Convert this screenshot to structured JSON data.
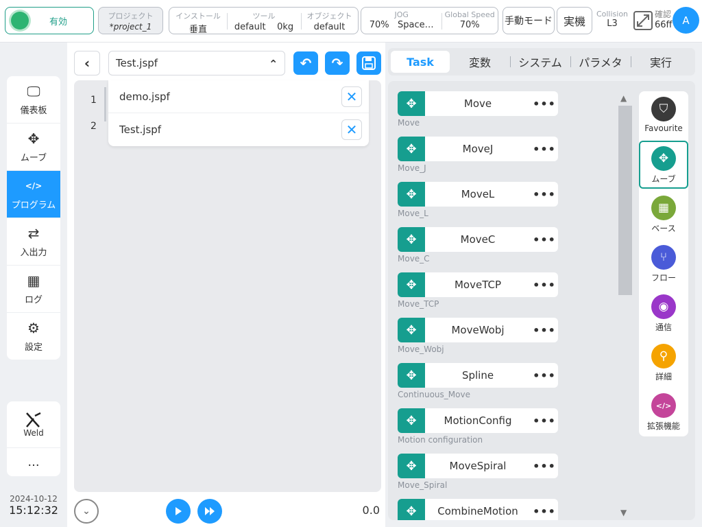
{
  "topbar": {
    "enable_label": "有効",
    "project": {
      "label": "プロジェクト",
      "value": "*project_1"
    },
    "install": {
      "label": "インストール",
      "value": "垂直"
    },
    "tool": {
      "label": "ツール",
      "value_name": "default",
      "value_weight": "0kg"
    },
    "object": {
      "label": "オブジェクト",
      "value": "default"
    },
    "jog": {
      "label": "JOG",
      "value_pct": "70%",
      "value_space": "Space…"
    },
    "global_speed": {
      "label": "Global Speed",
      "value": "70%"
    },
    "manual_mode": "手動モード",
    "real_machine": "実機",
    "collision": {
      "label": "Collision",
      "value": "L3"
    },
    "confirm": {
      "label": "確認",
      "value": "66ff"
    },
    "avatar_letter": "A"
  },
  "sidebar": {
    "items": [
      {
        "label": "儀表板",
        "icon": "monitor-icon"
      },
      {
        "label": "ムーブ",
        "icon": "move-icon"
      },
      {
        "label": "プログラム",
        "icon": "code-icon"
      },
      {
        "label": "入出力",
        "icon": "io-icon"
      },
      {
        "label": "ログ",
        "icon": "calendar-icon"
      },
      {
        "label": "設定",
        "icon": "gear-icon"
      }
    ],
    "weld_label": "Weld",
    "more_label": "..."
  },
  "clock": {
    "date": "2024-10-12",
    "time": "15:12:32"
  },
  "editor": {
    "current_file": "Test.jspf",
    "line_numbers": [
      "1",
      "2"
    ],
    "open_files": [
      "demo.jspf",
      "Test.jspf"
    ],
    "speed_value": "0.0"
  },
  "tabs": [
    "Task",
    "変数",
    "システム",
    "パラメタ",
    "実行"
  ],
  "commands": [
    {
      "name": "Move",
      "sub": "Move"
    },
    {
      "name": "MoveJ",
      "sub": "Move_J"
    },
    {
      "name": "MoveL",
      "sub": "Move_L"
    },
    {
      "name": "MoveC",
      "sub": "Move_C"
    },
    {
      "name": "MoveTCP",
      "sub": "Move_TCP"
    },
    {
      "name": "MoveWobj",
      "sub": "Move_Wobj"
    },
    {
      "name": "Spline",
      "sub": "Continuous_Move"
    },
    {
      "name": "MotionConfig",
      "sub": "Motion configuration"
    },
    {
      "name": "MoveSpiral",
      "sub": "Move_Spiral"
    },
    {
      "name": "CombineMotion",
      "sub": ""
    }
  ],
  "categories": [
    {
      "label": "Favourite",
      "color": "#3a3a3a"
    },
    {
      "label": "ムーブ",
      "color": "#169e8f"
    },
    {
      "label": "ベース",
      "color": "#7aa83a"
    },
    {
      "label": "フロー",
      "color": "#4a5bd8"
    },
    {
      "label": "通信",
      "color": "#9a37c9"
    },
    {
      "label": "詳細",
      "color": "#f5a300"
    },
    {
      "label": "拡張機能",
      "color": "#c4459a"
    }
  ],
  "colors": {
    "accent": "#1e9bff",
    "teal": "#169e8f",
    "green": "#2db472"
  }
}
